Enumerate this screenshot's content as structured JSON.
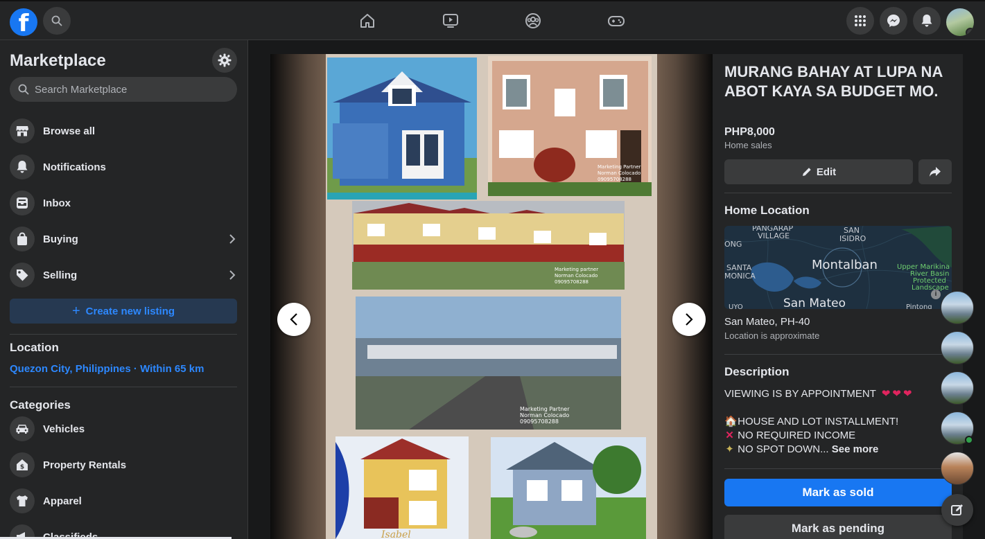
{
  "sidebar": {
    "title": "Marketplace",
    "search_placeholder": "Search Marketplace",
    "items": [
      {
        "label": "Browse all"
      },
      {
        "label": "Notifications"
      },
      {
        "label": "Inbox"
      },
      {
        "label": "Buying"
      },
      {
        "label": "Selling"
      }
    ],
    "create_label": "Create new listing",
    "location_heading": "Location",
    "location_value": "Quezon City, Philippines · Within 65 km",
    "categories_heading": "Categories",
    "categories": [
      {
        "label": "Vehicles"
      },
      {
        "label": "Property Rentals"
      },
      {
        "label": "Apparel"
      },
      {
        "label": "Classifieds"
      }
    ]
  },
  "listing": {
    "title": "MURANG BAHAY AT LUPA NA ABOT KAYA SA BUDGET MO.",
    "price": "PHP8,000",
    "category": "Home sales",
    "edit_label": "Edit",
    "location_heading": "Home Location",
    "map_labels": {
      "pangarap": "PANGARAP",
      "village": "VILLAGE",
      "san": "SAN",
      "isidro": "ISIDRO",
      "ong": "ONG",
      "santa": "SANTA",
      "monica": "MONICA",
      "montalban": "Montalban",
      "upper_marikina": "Upper Marikina",
      "river_basin": "River Basin",
      "protected": "Protected",
      "landscape": "Landscape",
      "san_mateo": "San Mateo",
      "uyo": "UYO",
      "pintong": "Pintong"
    },
    "location": "San Mateo, PH-40",
    "location_note": "Location is approximate",
    "description_heading": "Description",
    "desc_line1": "VIEWING IS BY APPOINTMENT",
    "desc_line2": "HOUSE AND LOT INSTALLMENT!",
    "desc_line3": "NO REQUIRED INCOME",
    "desc_line4": "NO SPOT DOWN...",
    "see_more": "See more",
    "mark_sold": "Mark as sold",
    "mark_pending": "Mark as pending"
  },
  "photo_captions": {
    "c1a": "Marketing Partner",
    "c1b": "Norman Colocado",
    "c1c": "09095708288",
    "c2a": "Marketing partner",
    "c2b": "Norman Colocado",
    "c2c": "09095708288",
    "c3a": "Marketing Partner",
    "c3b": "Norman Colocado",
    "c3c": "09095708288",
    "brand": "Isabel"
  },
  "colors": {
    "accent": "#1877f2",
    "link": "#2d88ff",
    "surface": "#242526",
    "background": "#18191a"
  }
}
